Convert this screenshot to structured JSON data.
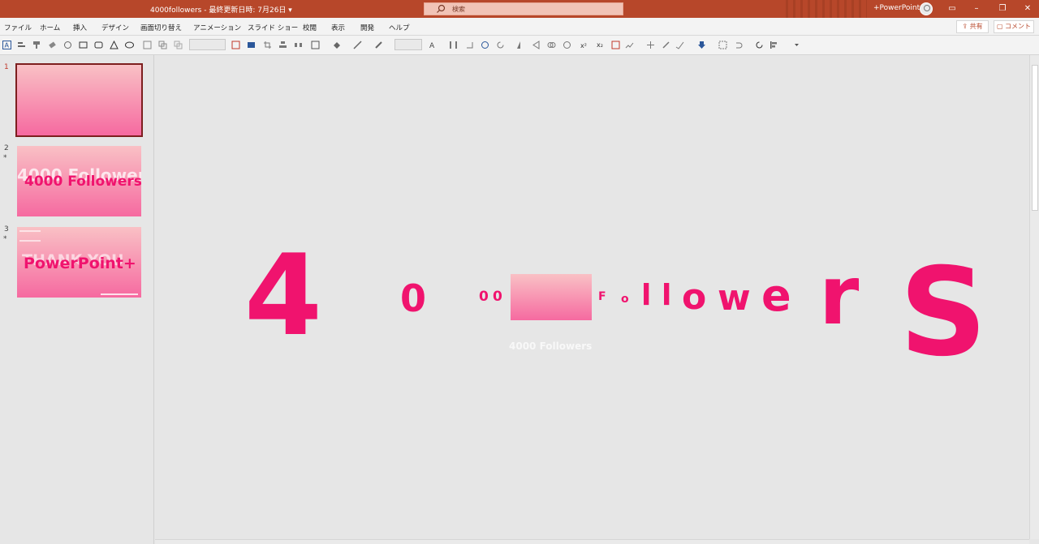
{
  "window": {
    "doc_title": "4000followers - 最終更新日時: 7月26日 ▾",
    "search_placeholder": "検索",
    "app_name": "+PowerPoint",
    "colors": {
      "titlebar": "#b7472a",
      "accent_pink": "#f0136e",
      "selected_border": "#7d1f1f"
    }
  },
  "menu": {
    "items": [
      "ファイル",
      "ホーム",
      "挿入",
      "デザイン",
      "画面切り替え",
      "アニメーション",
      "スライド ショー",
      "校閲",
      "表示",
      "開発",
      "ヘルプ"
    ],
    "share_label": "共有",
    "comment_label": "コメント"
  },
  "slides": [
    {
      "number": "1",
      "marker": ""
    },
    {
      "number": "2",
      "marker": "*",
      "ghost_text": "4000 Follower",
      "title": "4000 Followers"
    },
    {
      "number": "3",
      "marker": "*",
      "ghost_text": "THANK YOU",
      "title": "PowerPoint+"
    }
  ],
  "canvas": {
    "letters": [
      "4",
      "0",
      "0",
      "0",
      "F",
      "o",
      "l",
      "l",
      "o",
      "w",
      "e",
      "r",
      "S"
    ],
    "ghost_text": "4000 Followers"
  }
}
